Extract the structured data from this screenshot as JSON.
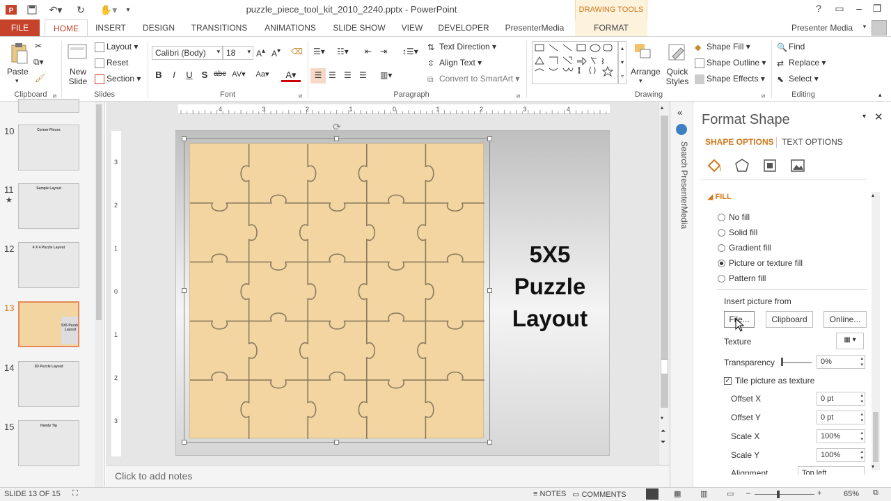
{
  "titlebar": {
    "doc_title": "puzzle_piece_tool_kit_2010_2240.pptx - PowerPoint",
    "context_tab": "DRAWING TOOLS",
    "user": "Presenter Media"
  },
  "tabs": {
    "file": "FILE",
    "home": "HOME",
    "insert": "INSERT",
    "design": "DESIGN",
    "transitions": "TRANSITIONS",
    "animations": "ANIMATIONS",
    "slideshow": "SLIDE SHOW",
    "view": "VIEW",
    "developer": "DEVELOPER",
    "presentermedia": "PresenterMedia",
    "format": "FORMAT"
  },
  "ribbon": {
    "clipboard": {
      "label": "Clipboard",
      "paste": "Paste"
    },
    "slides": {
      "label": "Slides",
      "new_slide": "New Slide",
      "layout": "Layout",
      "reset": "Reset",
      "section": "Section"
    },
    "font": {
      "label": "Font",
      "name": "Calibri (Body)",
      "size": "18"
    },
    "paragraph": {
      "label": "Paragraph",
      "text_direction": "Text Direction",
      "align_text": "Align Text",
      "smartart": "Convert to SmartArt"
    },
    "drawing": {
      "label": "Drawing",
      "arrange": "Arrange",
      "quick_styles": "Quick Styles",
      "shape_fill": "Shape Fill",
      "shape_outline": "Shape Outline",
      "shape_effects": "Shape Effects"
    },
    "editing": {
      "label": "Editing",
      "find": "Find",
      "replace": "Replace",
      "select": "Select"
    }
  },
  "thumbnails": [
    {
      "num": "10",
      "title": "Corner Pieces",
      "star": false
    },
    {
      "num": "11",
      "title": "Sample Layout",
      "star": true
    },
    {
      "num": "12",
      "title": "4 X 4 Puzzle Layout",
      "star": false
    },
    {
      "num": "13",
      "title": "5X5 Puzzle Layout",
      "star": false
    },
    {
      "num": "14",
      "title": "3D Puzzle Layout",
      "star": false
    },
    {
      "num": "15",
      "title": "Handy Tip",
      "star": false
    }
  ],
  "slide": {
    "title_lines": [
      "5X5",
      "Puzzle",
      "Layout"
    ]
  },
  "notes_placeholder": "Click to add notes",
  "addin_label": "Search PresenterMedia",
  "format_pane": {
    "title": "Format Shape",
    "tab_shape": "SHAPE OPTIONS",
    "tab_text": "TEXT OPTIONS",
    "section": "FILL",
    "fill_options": [
      "No fill",
      "Solid fill",
      "Gradient fill",
      "Picture or texture fill",
      "Pattern fill"
    ],
    "selected_fill": "Picture or texture fill",
    "insert_from": "Insert picture from",
    "btn_file": "File...",
    "btn_clipboard": "Clipboard",
    "btn_online": "Online...",
    "texture": "Texture",
    "transparency": "Transparency",
    "transparency_value": "0%",
    "tile": "Tile picture as texture",
    "offset_x": "Offset X",
    "offset_x_value": "0 pt",
    "offset_y": "Offset Y",
    "offset_y_value": "0 pt",
    "scale_x": "Scale X",
    "scale_x_value": "100%",
    "scale_y": "Scale Y",
    "scale_y_value": "100%",
    "alignment": "Alignment",
    "alignment_value": "Top left"
  },
  "status": {
    "slide": "SLIDE 13 OF 15",
    "notes": "NOTES",
    "comments": "COMMENTS",
    "zoom": "65%"
  }
}
